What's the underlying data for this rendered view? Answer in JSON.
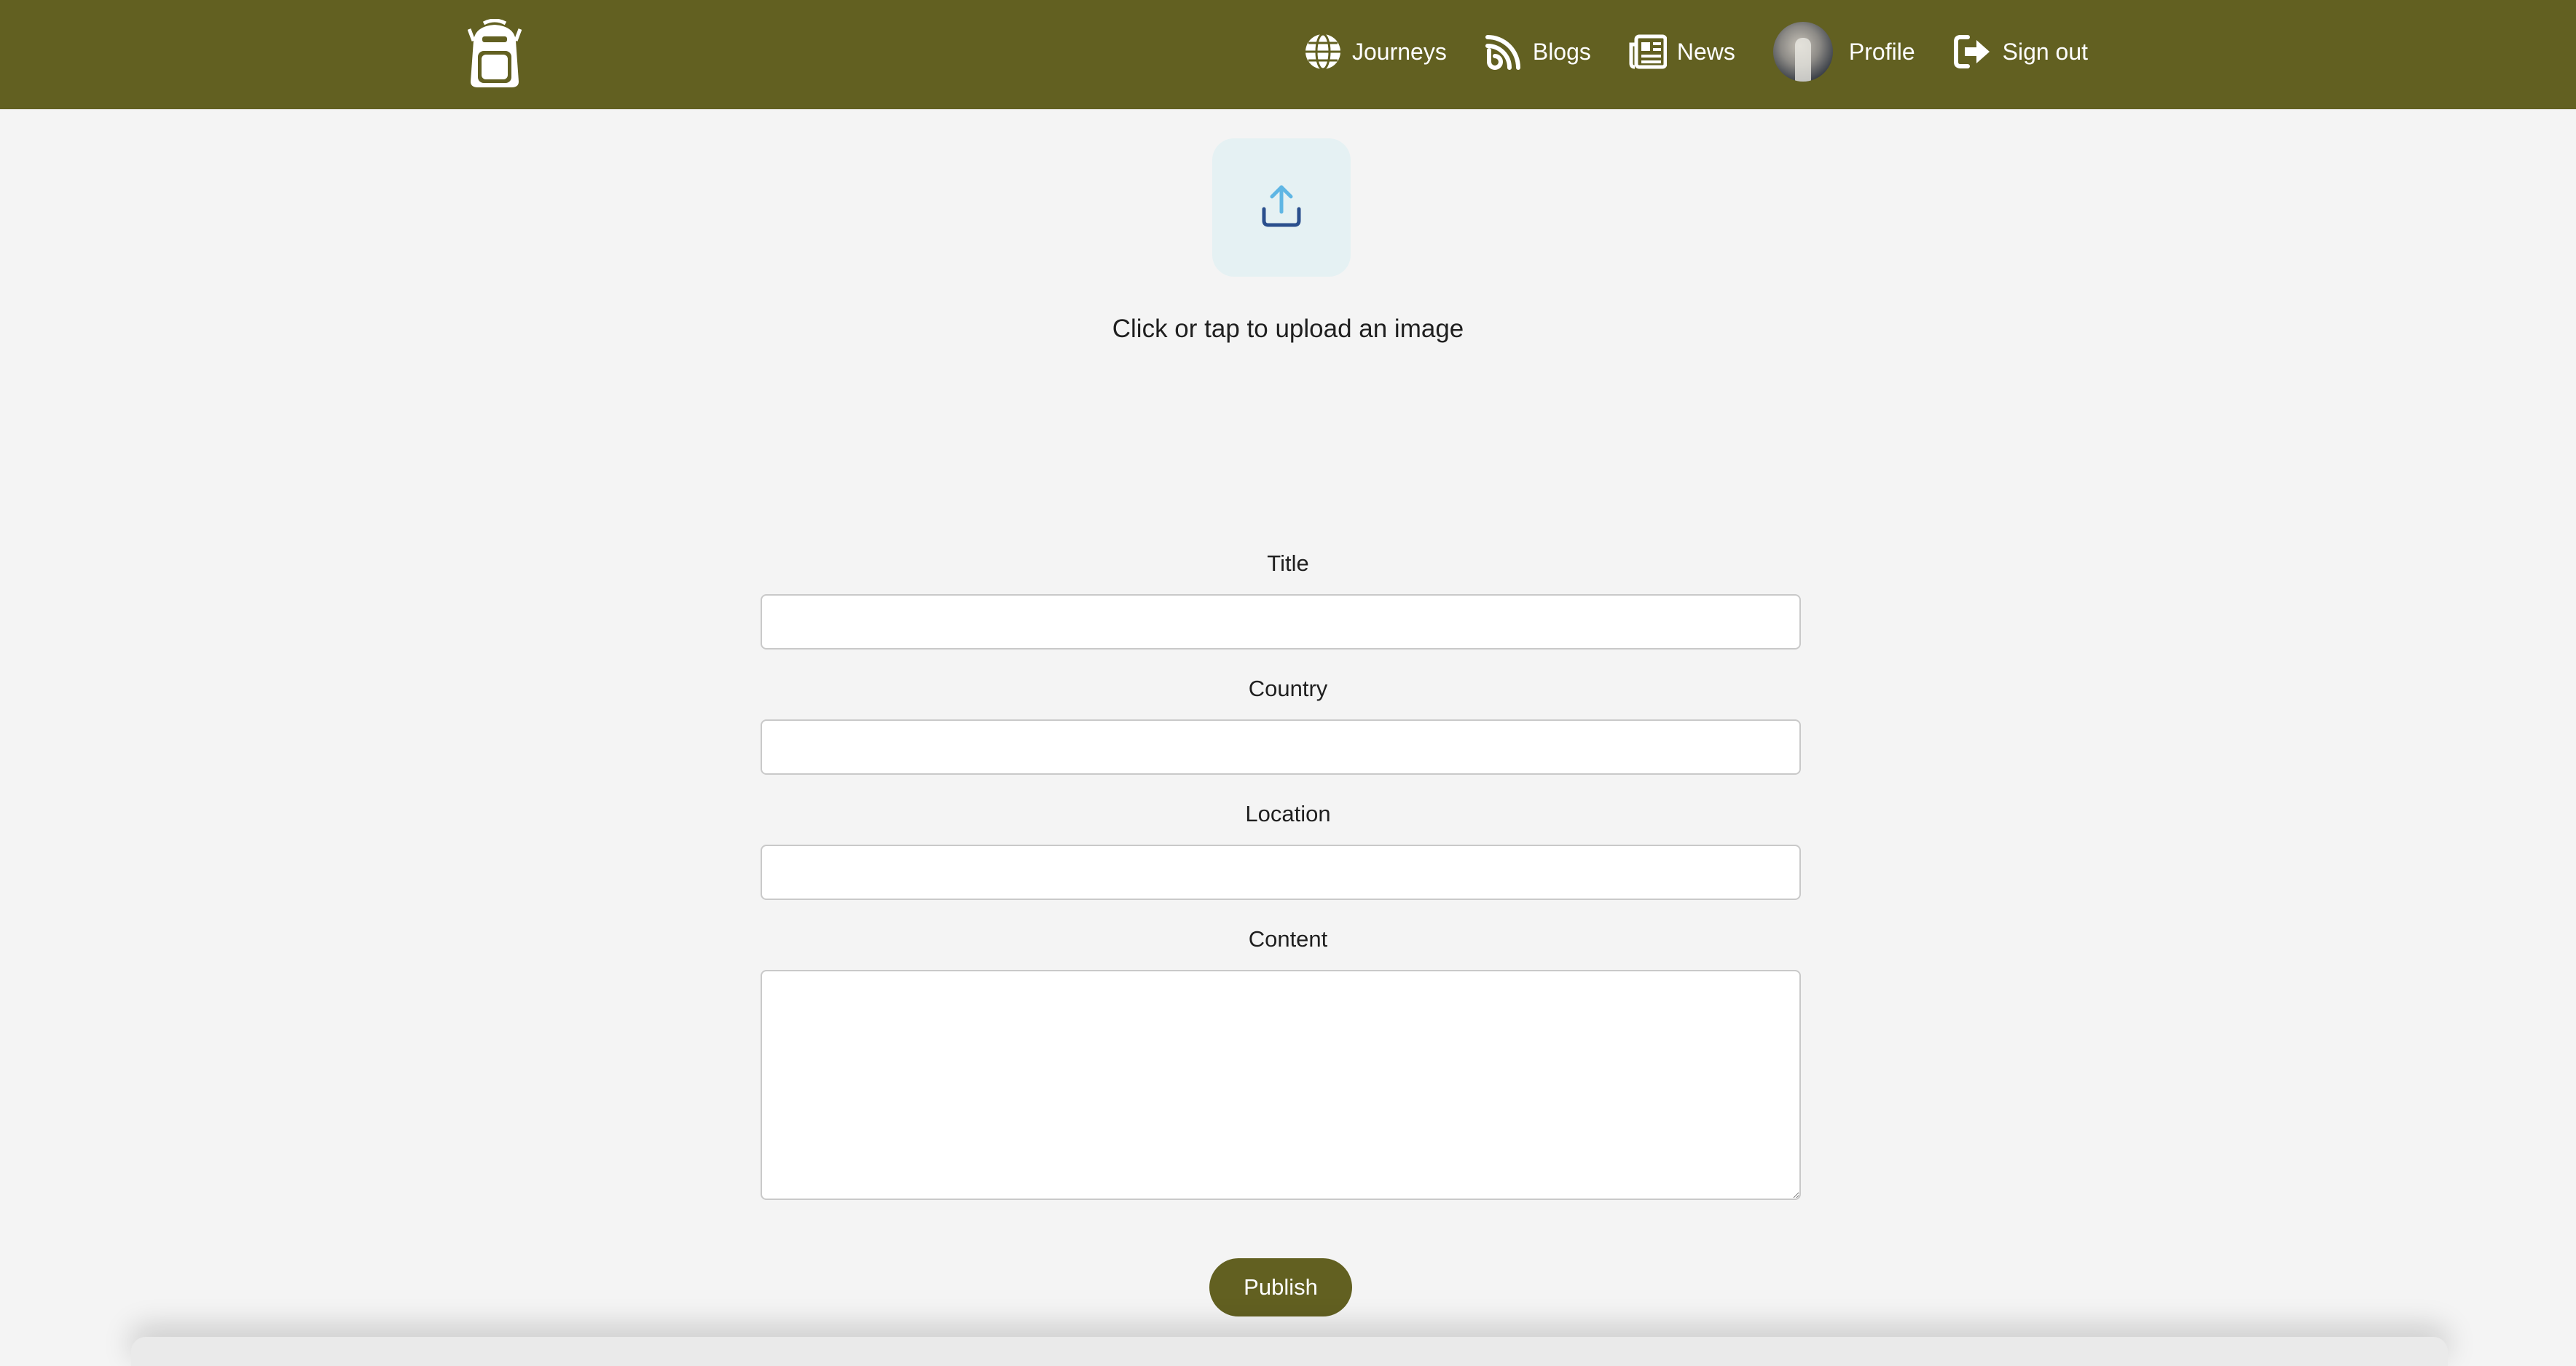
{
  "nav": {
    "logo_icon": "backpack-icon",
    "items": [
      {
        "label": "Journeys",
        "icon": "globe-icon"
      },
      {
        "label": "Blogs",
        "icon": "blog-icon"
      },
      {
        "label": "News",
        "icon": "newspaper-icon"
      },
      {
        "label": "Profile",
        "icon": "avatar"
      },
      {
        "label": "Sign out",
        "icon": "sign-out-icon"
      }
    ]
  },
  "upload": {
    "icon": "upload-icon",
    "text": "Click or tap to upload an image"
  },
  "form": {
    "title_label": "Title",
    "title_value": "",
    "country_label": "Country",
    "country_value": "",
    "location_label": "Location",
    "location_value": "",
    "content_label": "Content",
    "content_value": "",
    "publish_label": "Publish"
  },
  "colors": {
    "brand": "#626021",
    "background": "#f4f4f4",
    "upload_bg": "#e5f1f3",
    "upload_arrow": "#5fb6e4",
    "upload_tray": "#2a4f8d"
  }
}
